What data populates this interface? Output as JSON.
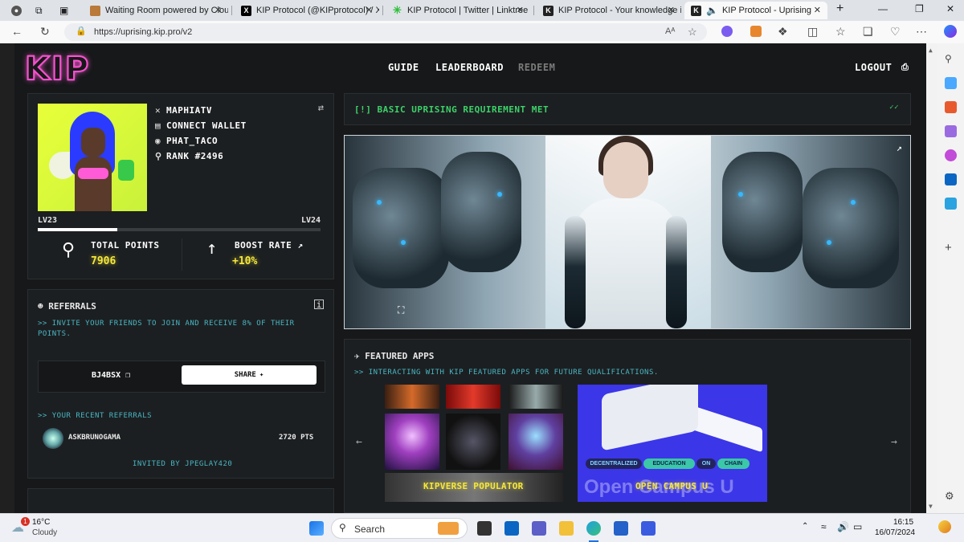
{
  "browser": {
    "tabs": [
      {
        "title": "Waiting Room powered by Clou",
        "active": false
      },
      {
        "title": "KIP Protocol (@KIPprotocol) / X",
        "active": false
      },
      {
        "title": "KIP Protocol | Twitter | Linktree",
        "active": false
      },
      {
        "title": "KIP Protocol - Your knowledge is",
        "active": false
      },
      {
        "title": "KIP Protocol - Uprising",
        "active": true
      }
    ],
    "url": "https://uprising.kip.pro/v2",
    "read_aloud_label": "Aᴬ"
  },
  "site": {
    "logo": "KIP",
    "nav": [
      {
        "label": "GUIDE",
        "enabled": true
      },
      {
        "label": "LEADERBOARD",
        "enabled": true
      },
      {
        "label": "REDEEM",
        "enabled": false
      }
    ],
    "logout_label": "LOGOUT"
  },
  "profile": {
    "x_handle": "MAPHIATV",
    "wallet_label": "CONNECT WALLET",
    "discord_handle": "PHAT_TACO",
    "rank": "RANK #2496",
    "level_current": "LV23",
    "level_next": "LV24",
    "level_progress": 0.28,
    "total_points_label": "TOTAL POINTS",
    "total_points": "7906",
    "boost_label": "BOOST RATE",
    "boost_value": "+10%"
  },
  "requirement": {
    "text": "[!] BASIC UPRISING REQUIREMENT MET",
    "check": "✓✓"
  },
  "referrals": {
    "title": "REFERRALS",
    "description": ">> INVITE YOUR FRIENDS TO JOIN AND RECEIVE 8% OF THEIR POINTS.",
    "code": "BJ4BSX",
    "share_label": "SHARE",
    "recent_title": ">> YOUR RECENT REFERRALS",
    "recent": [
      {
        "name": "ASKBRUNOGAMA",
        "points": "2720 PTS"
      }
    ],
    "invited_by": "INVITED BY JPEGLAY420"
  },
  "featured": {
    "title": "FEATURED APPS",
    "description": ">> INTERACTING WITH KIP FEATURED APPS FOR FUTURE QUALIFICATIONS.",
    "apps": [
      {
        "name": "KIPVERSE POPULATOR"
      },
      {
        "name": "OPEN CAMPUS U",
        "pills": [
          "DECENTRALIZED",
          "EDUCATION",
          "ON",
          "CHAIN"
        ],
        "banner_text": "Open Campus U"
      }
    ]
  },
  "taskbar": {
    "weather_temp": "16°C",
    "weather_desc": "Cloudy",
    "notification_count": "1",
    "search_placeholder": "Search",
    "time": "16:15",
    "date": "16/07/2024"
  },
  "colors": {
    "page_bg": "#161819",
    "accent_yellow": "#f5e73a",
    "accent_cyan": "#49b6c4",
    "accent_green": "#3ed16a",
    "logo_pink": "#ff4fd1"
  }
}
